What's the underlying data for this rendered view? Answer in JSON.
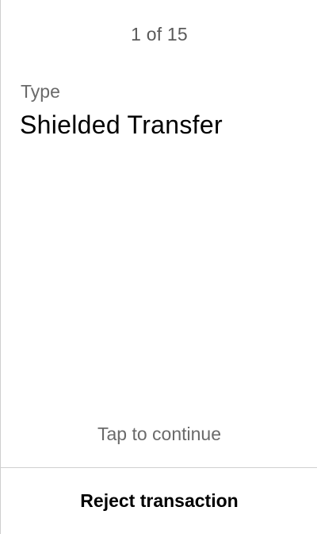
{
  "pager": {
    "text": "1 of 15",
    "current": 1,
    "total": 15
  },
  "field": {
    "label": "Type",
    "value": "Shielded Transfer"
  },
  "footer": {
    "continue_label": "Tap to continue",
    "reject_label": "Reject transaction"
  },
  "colors": {
    "background": "#ffffff",
    "primary_text": "#000000",
    "secondary_text": "#6a6a6a",
    "divider": "#cfcfcf"
  }
}
